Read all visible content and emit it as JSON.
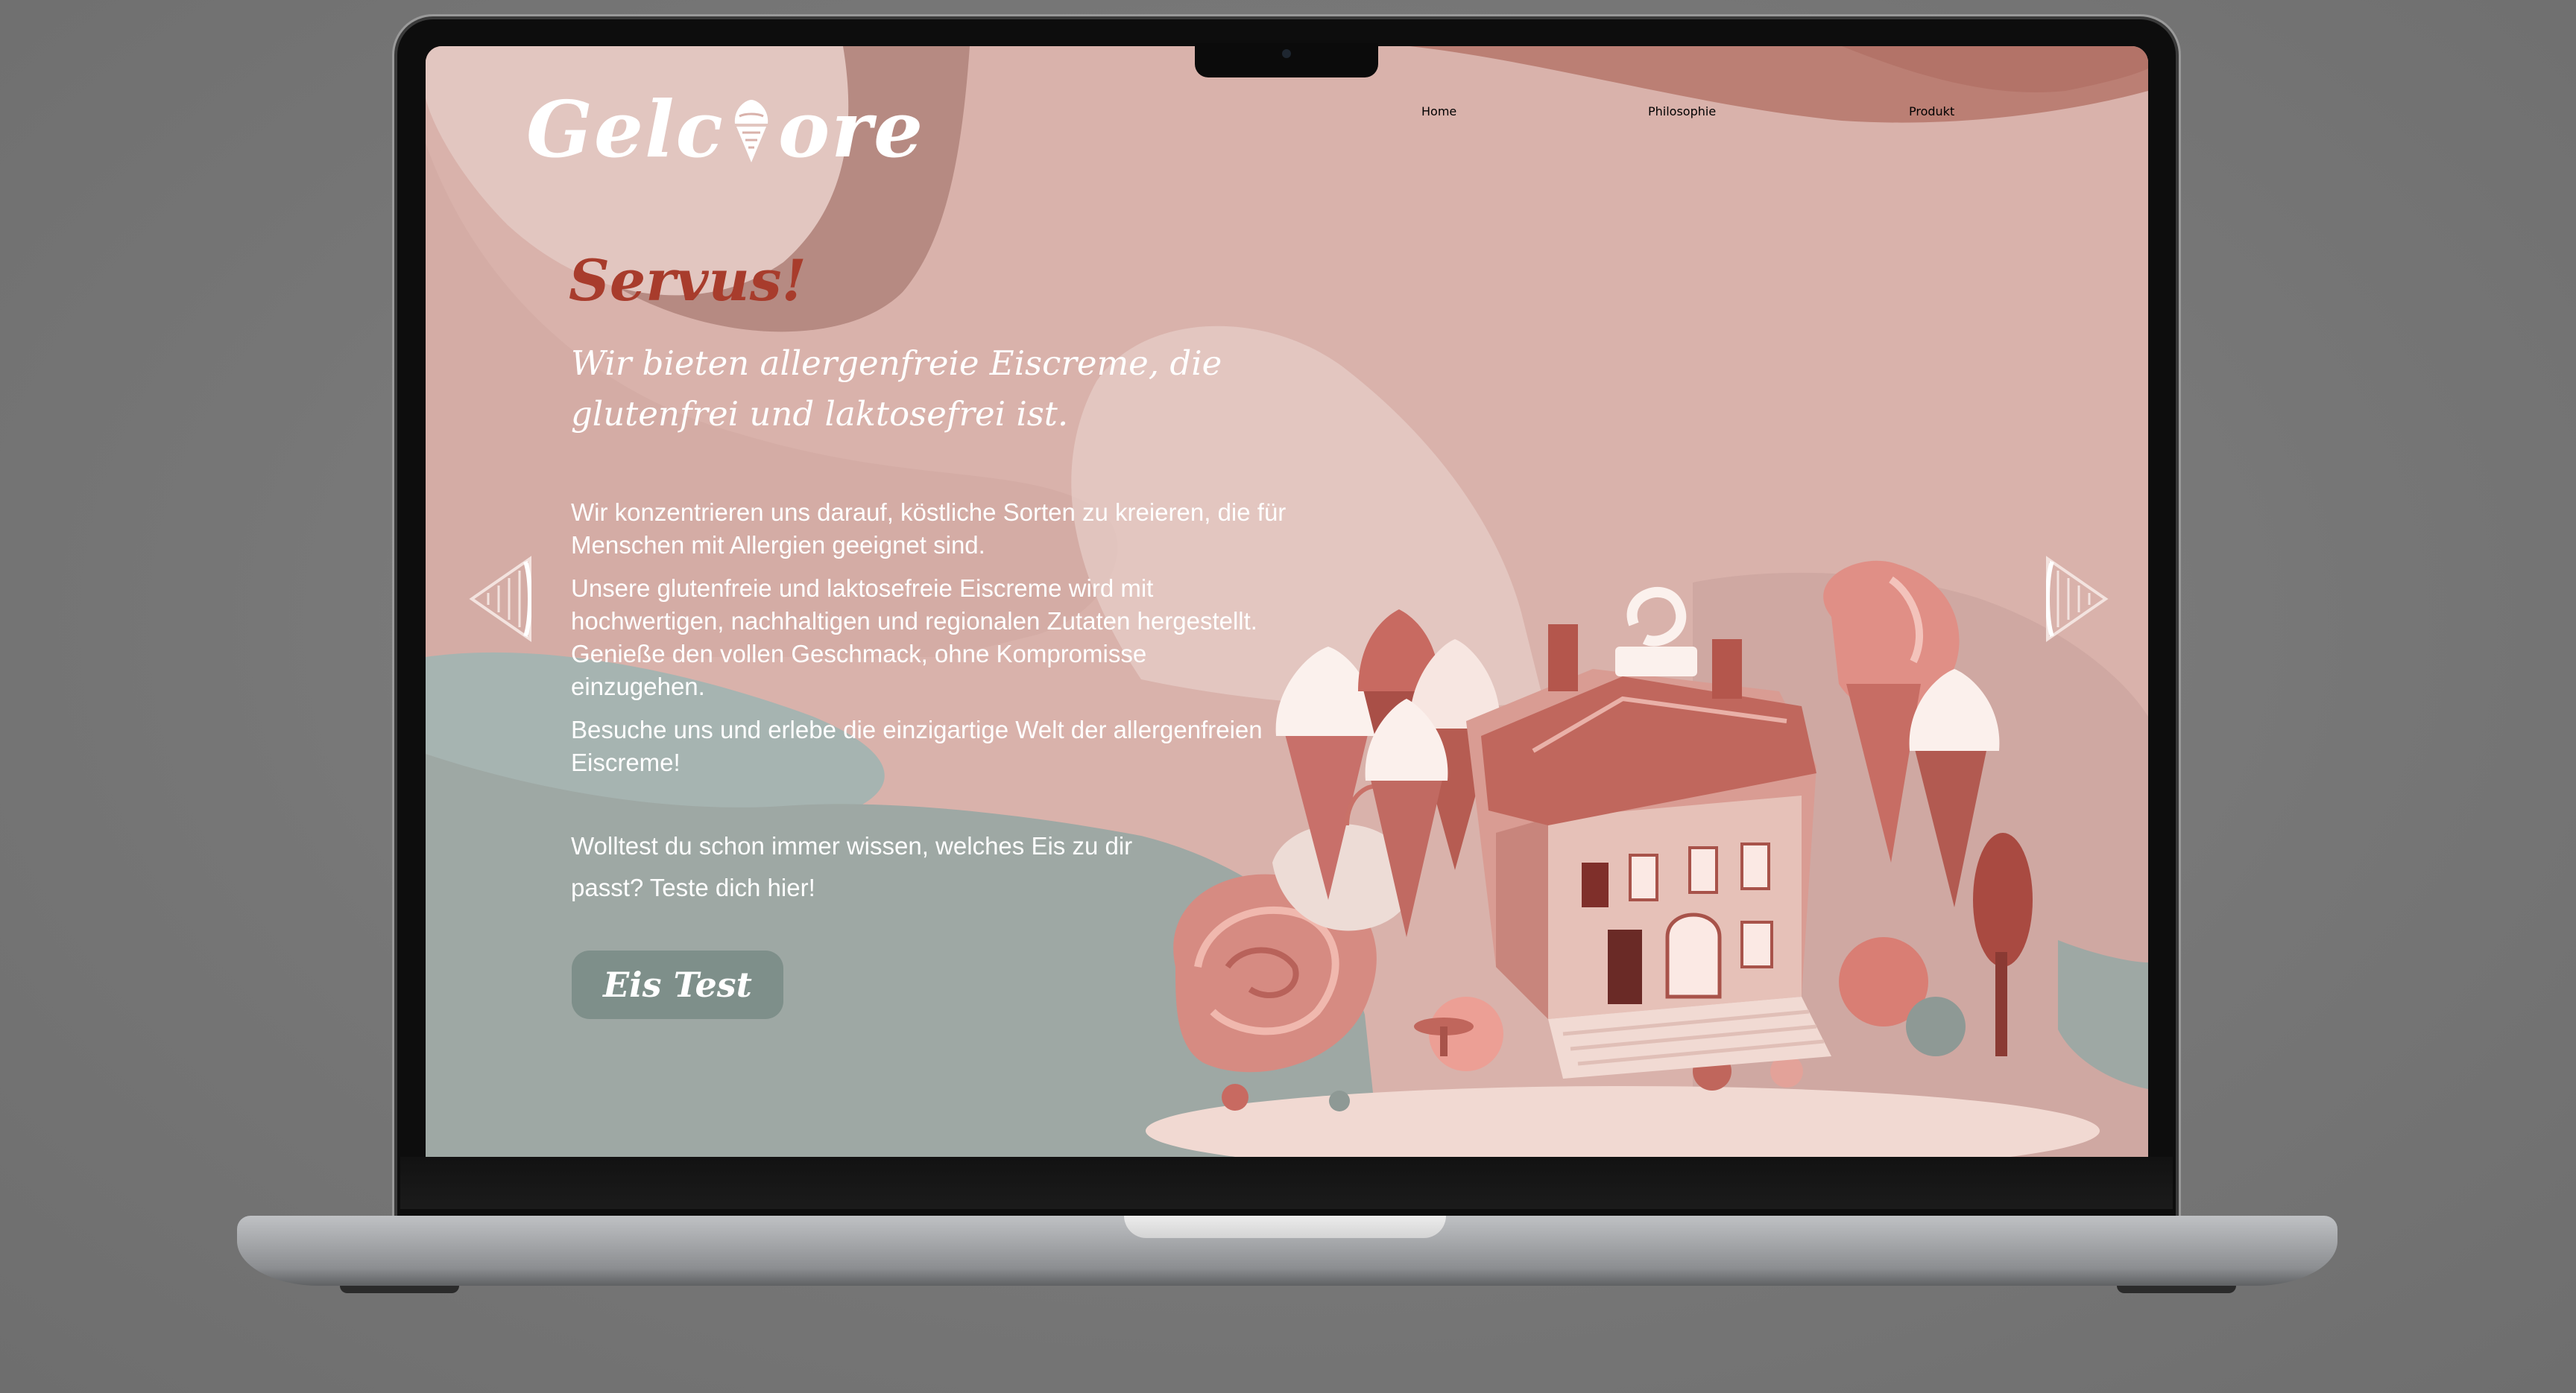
{
  "site": {
    "logo_text_before": "Gelc",
    "logo_text_after": "ore",
    "logo_icon": "ice-cream-cone-icon"
  },
  "nav": {
    "items": [
      {
        "label": "Home"
      },
      {
        "label": "Philosophie"
      },
      {
        "label": "Produkt"
      }
    ]
  },
  "hero": {
    "greeting": "Servus!",
    "tagline": "Wir bieten allergenfreie Eiscreme, die glutenfrei und laktosefrei ist.",
    "paragraphs": [
      "Wir konzentrieren uns darauf, köstliche Sorten zu kreieren, die für Menschen mit Allergien geeignet sind.",
      "Unsere glutenfreie und laktosefreie Eiscreme wird mit hochwertigen, nachhaltigen und regionalen Zutaten hergestellt. Genieße den vollen Geschmack, ohne Kompromisse einzugehen.",
      "Besuche uns und erlebe die einzigartige Welt der allergenfreien Eiscreme!",
      "Wolltest du schon immer wissen, welches Eis zu dir passt? Teste dich hier!"
    ],
    "cta_label": "Eis Test"
  },
  "slider": {
    "prev_icon": "cone-arrow-left-icon",
    "next_icon": "cone-arrow-right-icon"
  },
  "illustration": {
    "subject": "ice-cream-house-illustration"
  },
  "colors": {
    "background_pink": "#d9b2ab",
    "accent_red": "#a83c2c",
    "sage": "#9ea8a4",
    "button": "#7e8f8a",
    "text": "#ffffff"
  }
}
